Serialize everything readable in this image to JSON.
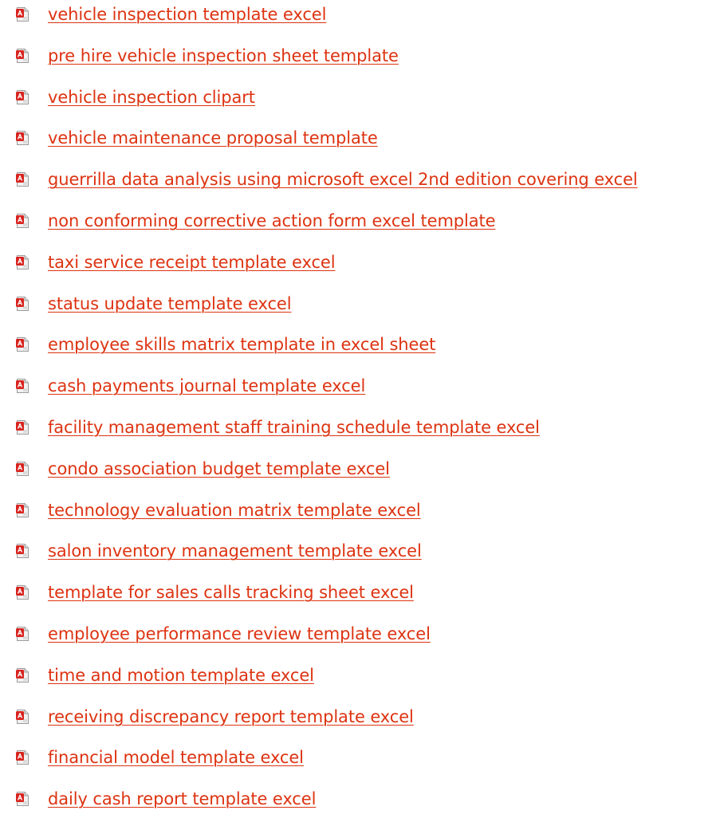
{
  "colors": {
    "link": "#dd3311",
    "icon_red": "#d8231e",
    "icon_page": "#f2f2f2"
  },
  "icon": "pdf-document-icon",
  "links": [
    {
      "label": "vehicle inspection template excel"
    },
    {
      "label": "pre hire vehicle inspection sheet template"
    },
    {
      "label": "vehicle inspection clipart"
    },
    {
      "label": "vehicle maintenance proposal template"
    },
    {
      "label": "guerrilla data analysis using microsoft excel 2nd edition covering excel"
    },
    {
      "label": "non conforming corrective action form excel template"
    },
    {
      "label": "taxi service receipt template excel"
    },
    {
      "label": "status update template excel"
    },
    {
      "label": "employee skills matrix template in excel sheet"
    },
    {
      "label": "cash payments journal template excel"
    },
    {
      "label": "facility management staff training schedule template excel"
    },
    {
      "label": "condo association budget template excel"
    },
    {
      "label": "technology evaluation matrix template excel"
    },
    {
      "label": "salon inventory management template excel"
    },
    {
      "label": "template for sales calls tracking sheet excel"
    },
    {
      "label": "employee performance review template excel"
    },
    {
      "label": "time and motion template excel"
    },
    {
      "label": "receiving discrepancy report template excel"
    },
    {
      "label": "financial model template excel"
    },
    {
      "label": "daily cash report template excel"
    }
  ]
}
